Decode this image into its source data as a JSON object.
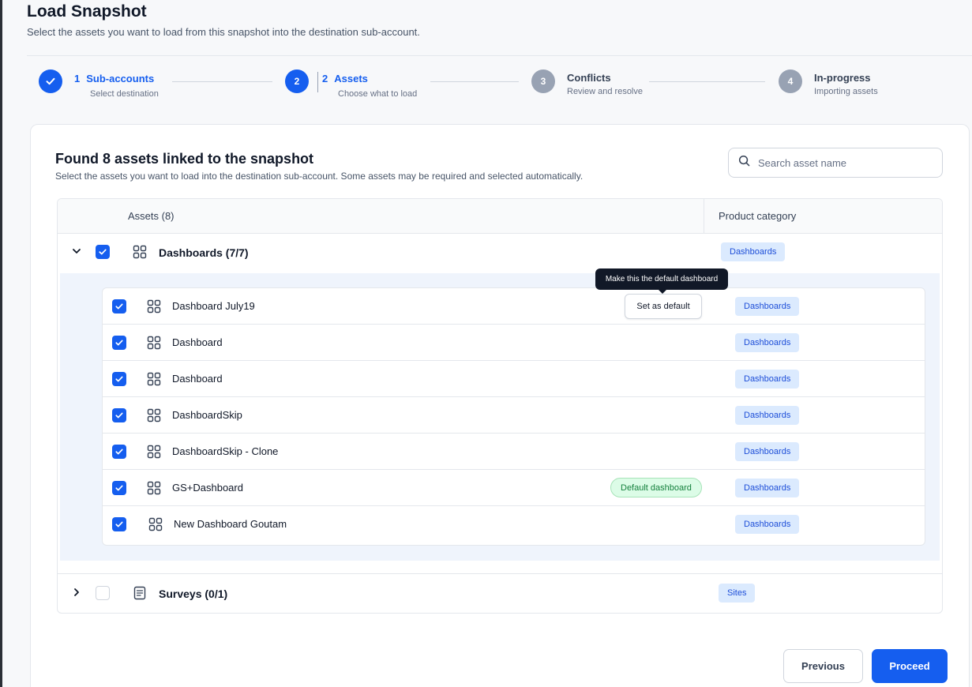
{
  "page": {
    "title": "Load Snapshot",
    "subtitle": "Select the assets you want to load from this snapshot into the destination sub-account."
  },
  "stepper": {
    "steps": [
      {
        "number": "1",
        "title": "Sub-accounts",
        "description": "Select destination",
        "status": "completed"
      },
      {
        "number": "2",
        "title": "Assets",
        "description": "Choose what to load",
        "status": "active"
      },
      {
        "number": "3",
        "title": "Conflicts",
        "description": "Review and resolve",
        "status": "pending"
      },
      {
        "number": "4",
        "title": "In-progress",
        "description": "Importing assets",
        "status": "pending"
      }
    ]
  },
  "card": {
    "title": "Found 8 assets linked to the snapshot",
    "subtitle": "Select the assets you want to load into the destination sub-account. Some assets may be required and selected automatically.",
    "search_placeholder": "Search asset name"
  },
  "table": {
    "columns": {
      "assets": "Assets (8)",
      "category": "Product category"
    },
    "groups": [
      {
        "name": "Dashboards (7/7)",
        "category": "Dashboards",
        "expanded": true,
        "checked": true,
        "items": [
          {
            "name": "Dashboard July19",
            "category": "Dashboards",
            "checked": true,
            "action": "Set as default"
          },
          {
            "name": "Dashboard",
            "category": "Dashboards",
            "checked": true
          },
          {
            "name": "Dashboard",
            "category": "Dashboards",
            "checked": true
          },
          {
            "name": "DashboardSkip",
            "category": "Dashboards",
            "checked": true
          },
          {
            "name": "DashboardSkip - Clone",
            "category": "Dashboards",
            "checked": true
          },
          {
            "name": "GS+Dashboard",
            "category": "Dashboards",
            "checked": true,
            "badge": "Default dashboard"
          },
          {
            "name": "New Dashboard Goutam",
            "category": "Dashboards",
            "checked": true
          }
        ]
      },
      {
        "name": "Surveys (0/1)",
        "category": "Sites",
        "expanded": false,
        "checked": false
      }
    ]
  },
  "tooltip": {
    "text": "Make this the default dashboard"
  },
  "footer": {
    "previous_label": "Previous",
    "proceed_label": "Proceed"
  },
  "colors": {
    "primary": "#155eef",
    "badge_bg": "#dbeafe",
    "success": "#15803d"
  }
}
